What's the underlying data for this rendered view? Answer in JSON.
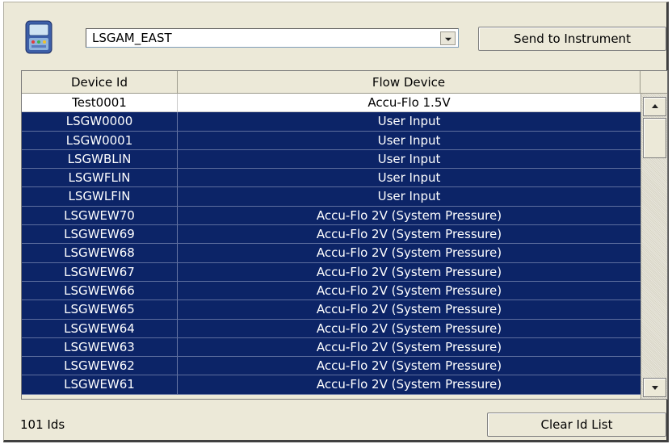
{
  "toolbar": {
    "app_icon": "pda-instrument-icon",
    "site_value": "LSGAM_EAST",
    "send_label": "Send to Instrument",
    "send_mnemonic": "e"
  },
  "grid": {
    "columns": [
      "Device Id",
      "Flow Device"
    ],
    "rows": [
      {
        "id": "Test0001",
        "flow": "Accu-Flo 1.5V",
        "selected": false
      },
      {
        "id": "LSGW0000",
        "flow": "User Input",
        "selected": true
      },
      {
        "id": "LSGW0001",
        "flow": "User Input",
        "selected": true
      },
      {
        "id": "LSGWBLIN",
        "flow": "User Input",
        "selected": true
      },
      {
        "id": "LSGWFLIN",
        "flow": "User Input",
        "selected": true
      },
      {
        "id": "LSGWLFIN",
        "flow": "User Input",
        "selected": true
      },
      {
        "id": "LSGWEW70",
        "flow": "Accu-Flo 2V (System Pressure)",
        "selected": true
      },
      {
        "id": "LSGWEW69",
        "flow": "Accu-Flo 2V (System Pressure)",
        "selected": true
      },
      {
        "id": "LSGWEW68",
        "flow": "Accu-Flo 2V (System Pressure)",
        "selected": true
      },
      {
        "id": "LSGWEW67",
        "flow": "Accu-Flo 2V (System Pressure)",
        "selected": true
      },
      {
        "id": "LSGWEW66",
        "flow": "Accu-Flo 2V (System Pressure)",
        "selected": true
      },
      {
        "id": "LSGWEW65",
        "flow": "Accu-Flo 2V (System Pressure)",
        "selected": true
      },
      {
        "id": "LSGWEW64",
        "flow": "Accu-Flo 2V (System Pressure)",
        "selected": true
      },
      {
        "id": "LSGWEW63",
        "flow": "Accu-Flo 2V (System Pressure)",
        "selected": true
      },
      {
        "id": "LSGWEW62",
        "flow": "Accu-Flo 2V (System Pressure)",
        "selected": true
      },
      {
        "id": "LSGWEW61",
        "flow": "Accu-Flo 2V (System Pressure)",
        "selected": true
      }
    ]
  },
  "footer": {
    "count_text": "101 Ids",
    "clear_label": "Clear Id List"
  },
  "colors": {
    "selection": "#0c2467",
    "window_bg": "#ece9d8"
  }
}
